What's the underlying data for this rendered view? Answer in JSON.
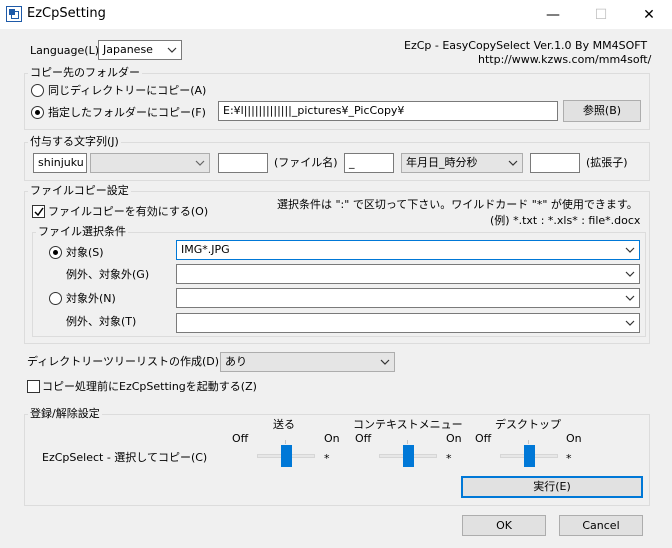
{
  "window": {
    "title": "EzCpSetting",
    "minimize": "—",
    "maximize": "☐",
    "close": "✕"
  },
  "language": {
    "label": "Language(L):",
    "value": "Japanese"
  },
  "about": {
    "line1": "EzCp - EasyCopySelect Ver.1.0 By MM4SOFT",
    "line2": "http://www.kzws.com/mm4soft/"
  },
  "dest": {
    "title": "コピー先のフォルダー",
    "same_dir": "同じディレクトリーにコピー(A)",
    "specified": "指定したフォルダーにコピー(F)",
    "path": "E:¥l|||||||||||||_pictures¥_PicCopy¥",
    "browse": "参照(B)"
  },
  "suffix": {
    "title": "付与する文字列(J)",
    "text1": "shinjuku",
    "combo1": "",
    "text2": "",
    "filename_label": "(ファイル名)",
    "text3": "_",
    "format": "年月日_時分秒",
    "text4": "",
    "ext_label": "(拡張子)"
  },
  "filecopy": {
    "title": "ファイルコピー設定",
    "enable": "ファイルコピーを有効にする(O)",
    "hint1": "選択条件は \":\" で区切って下さい。ワイルドカード \"*\" が使用できます。",
    "hint2": "(例) *.txt : *.xls* : file*.docx",
    "cond_title": "ファイル選択条件",
    "target": "対象(S)",
    "target_value": "IMG*.JPG",
    "except_target": "例外、対象外(G)",
    "except_target_value": "",
    "nontarget": "対象外(N)",
    "nontarget_value": "",
    "except_nontarget": "例外、対象(T)",
    "except_nontarget_value": ""
  },
  "tree": {
    "label": "ディレクトリーツリーリストの作成(D):",
    "value": "あり"
  },
  "launch": {
    "label": "コピー処理前にEzCpSettingを起動する(Z)"
  },
  "register": {
    "title": "登録/解除設定",
    "col1": "送る",
    "col2": "コンテキストメニュー",
    "col3": "デスクトップ",
    "off": "Off",
    "on": "On",
    "row_label": "EzCpSelect - 選択してコピー(C)",
    "mark1": "*",
    "mark2": "*",
    "mark3": "*",
    "slider1": 0.5,
    "slider2": 0.5,
    "slider3": 0.5,
    "execute": "実行(E)"
  },
  "footer": {
    "ok": "OK",
    "cancel": "Cancel"
  },
  "colors": {
    "accent": "#0078d7",
    "background": "#f0f0f0"
  }
}
